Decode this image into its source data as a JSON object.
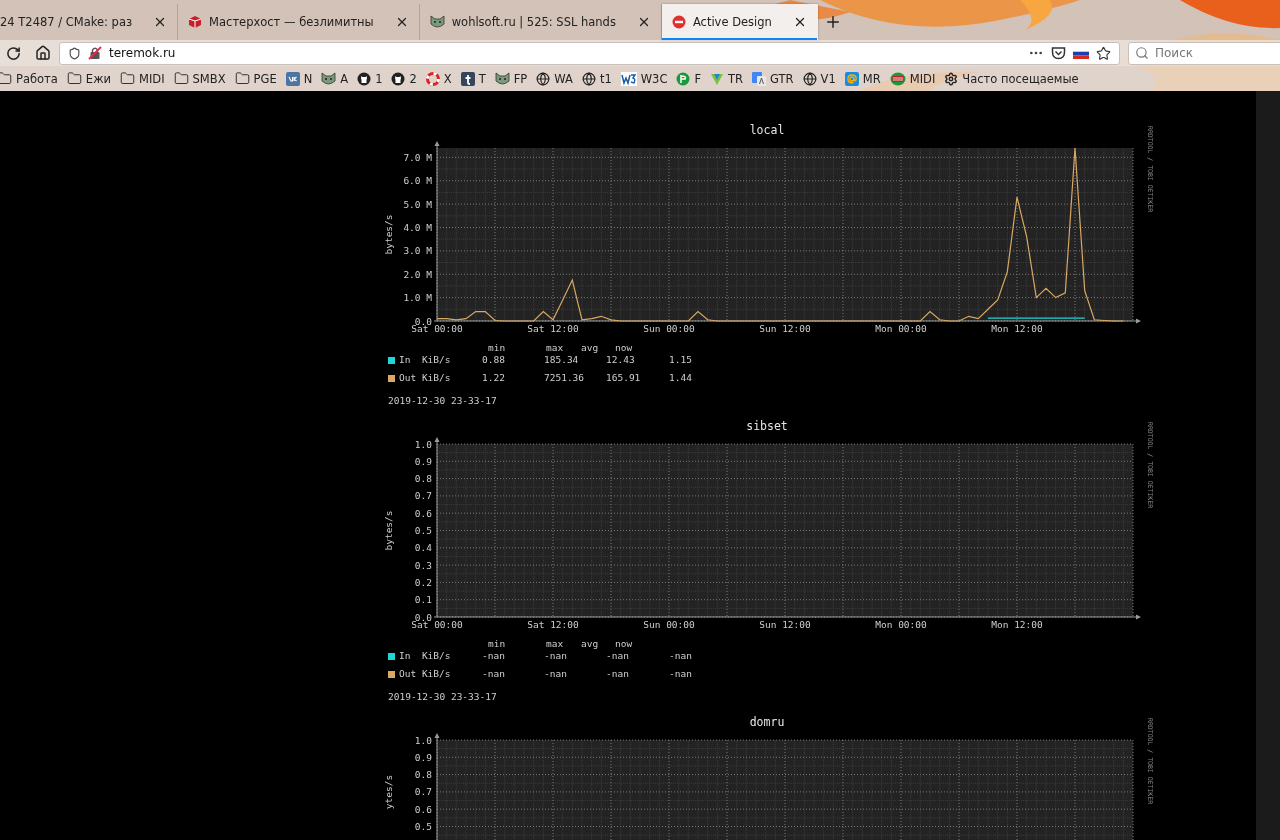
{
  "browser": {
    "tabs": [
      {
        "title": "24 T2487 / CMake: раз",
        "kind": "plain",
        "selected": false
      },
      {
        "title": "Мастерхост — безлимитны",
        "kind": "cube",
        "selected": false
      },
      {
        "title": "wohlsoft.ru | 525: SSL hands",
        "kind": "cat",
        "selected": false
      },
      {
        "title": "Active Design",
        "kind": "stop",
        "selected": true
      }
    ],
    "address_bar": {
      "url": "teremok.ru"
    },
    "search": {
      "placeholder": "Поиск"
    },
    "bookmarks": [
      {
        "label": "Работа",
        "kind": "folder"
      },
      {
        "label": "Ежи",
        "kind": "folder"
      },
      {
        "label": "MIDI",
        "kind": "folder"
      },
      {
        "label": "SMBX",
        "kind": "folder"
      },
      {
        "label": "PGE",
        "kind": "folder"
      },
      {
        "label": "N",
        "kind": "vk"
      },
      {
        "label": "A",
        "kind": "cat"
      },
      {
        "label": "1",
        "kind": "github"
      },
      {
        "label": "2",
        "kind": "github"
      },
      {
        "label": "X",
        "kind": "ring"
      },
      {
        "label": "T",
        "kind": "tsquare"
      },
      {
        "label": "FP",
        "kind": "cat"
      },
      {
        "label": "WA",
        "kind": "globe"
      },
      {
        "label": "t1",
        "kind": "globe"
      },
      {
        "label": "W3C",
        "kind": "w3c"
      },
      {
        "label": "F",
        "kind": "green"
      },
      {
        "label": "TR",
        "kind": "triangle"
      },
      {
        "label": "GTR",
        "kind": "translate"
      },
      {
        "label": "V1",
        "kind": "globe"
      },
      {
        "label": "MR",
        "kind": "at"
      },
      {
        "label": "MIDI",
        "kind": "midi"
      },
      {
        "label": "Часто посещаемые",
        "kind": "gear"
      }
    ]
  },
  "graphs": [
    {
      "title": "local",
      "credit": "RRDTOOL / TOBI OETIKER",
      "chart_data": {
        "type": "line",
        "grid": true,
        "ylabel": "bytes/s",
        "ylim": [
          0,
          7.4
        ],
        "categories": [
          "Sat 00:00",
          null,
          null,
          null,
          null,
          null,
          null,
          null,
          null,
          null,
          null,
          null,
          "Sat 12:00",
          null,
          null,
          null,
          null,
          null,
          null,
          null,
          null,
          null,
          null,
          null,
          "Sun 00:00",
          null,
          null,
          null,
          null,
          null,
          null,
          null,
          null,
          null,
          null,
          null,
          "Sun 12:00",
          null,
          null,
          null,
          null,
          null,
          null,
          null,
          null,
          null,
          null,
          null,
          "Mon 00:00",
          null,
          null,
          null,
          null,
          null,
          null,
          null,
          null,
          null,
          null,
          null,
          "Mon 12:00",
          null,
          null,
          null,
          null,
          null,
          null,
          null,
          null,
          null,
          null,
          null
        ],
        "yticks": [
          {
            "value": 0,
            "label": "0.0"
          },
          {
            "value": 1,
            "label": "1.0 M"
          },
          {
            "value": 2,
            "label": "2.0 M"
          },
          {
            "value": 3,
            "label": "3.0 M"
          },
          {
            "value": 4,
            "label": "4.0 M"
          },
          {
            "value": 5,
            "label": "5.0 M"
          },
          {
            "value": 6,
            "label": "6.0 M"
          },
          {
            "value": 7,
            "label": "7.0 M"
          }
        ],
        "series": [
          {
            "color": "#1ed6d6",
            "values": [
              null,
              null,
              null,
              null,
              null,
              null,
              null,
              null,
              null,
              null,
              null,
              null,
              null,
              null,
              null,
              null,
              null,
              null,
              null,
              null,
              null,
              null,
              null,
              null,
              null,
              null,
              null,
              null,
              null,
              null,
              null,
              null,
              null,
              null,
              null,
              null,
              null,
              null,
              null,
              null,
              null,
              null,
              null,
              null,
              null,
              null,
              null,
              null,
              null,
              null,
              null,
              null,
              null,
              null,
              null,
              null,
              null,
              0.12,
              0.12,
              0.12,
              0.12,
              0.12,
              0.12,
              0.12,
              0.12,
              0.12,
              0.12,
              0.12,
              null,
              null,
              null,
              null
            ]
          },
          {
            "color": "#d9a862",
            "values": [
              0.1,
              0.1,
              0.05,
              0.1,
              0.4,
              0.4,
              0.02,
              0,
              0,
              0,
              0,
              0.4,
              0.05,
              0.9,
              1.75,
              0.05,
              0.1,
              0.2,
              0.05,
              0,
              0,
              0,
              0,
              0,
              0,
              0,
              0,
              0.4,
              0.05,
              0,
              0,
              0,
              0,
              0,
              0,
              0,
              0,
              0,
              0,
              0,
              0,
              0,
              0,
              0,
              0,
              0,
              0,
              0,
              0,
              0,
              0,
              0.4,
              0.05,
              0,
              0,
              0.2,
              0.1,
              0.5,
              0.9,
              2.1,
              5.3,
              3.6,
              1.0,
              1.4,
              1.0,
              1.2,
              7.4,
              1.3,
              0.05,
              0.02,
              0,
              0
            ]
          }
        ]
      },
      "legend": {
        "columns": [
          "min",
          "max",
          "avg",
          "now"
        ],
        "rows": [
          {
            "label": "In  KiB/s",
            "color": "#1ed6d6",
            "values": [
              "0.88",
              "185.34",
              "12.43",
              "1.15"
            ]
          },
          {
            "label": "Out KiB/s",
            "color": "#d9a862",
            "values": [
              "1.22",
              "7251.36",
              "165.91",
              "1.44"
            ]
          }
        ]
      },
      "timestamp": "2019-12-30 23-33-17"
    },
    {
      "title": "sibset",
      "credit": "RRDTOOL / TOBI OETIKER",
      "chart_data": {
        "type": "line",
        "grid": true,
        "ylabel": "bytes/s",
        "ylim": [
          0,
          1
        ],
        "categories": [
          "Sat 00:00",
          null,
          null,
          null,
          null,
          null,
          null,
          null,
          null,
          null,
          null,
          null,
          "Sat 12:00",
          null,
          null,
          null,
          null,
          null,
          null,
          null,
          null,
          null,
          null,
          null,
          "Sun 00:00",
          null,
          null,
          null,
          null,
          null,
          null,
          null,
          null,
          null,
          null,
          null,
          "Sun 12:00",
          null,
          null,
          null,
          null,
          null,
          null,
          null,
          null,
          null,
          null,
          null,
          "Mon 00:00",
          null,
          null,
          null,
          null,
          null,
          null,
          null,
          null,
          null,
          null,
          null,
          "Mon 12:00",
          null,
          null,
          null,
          null,
          null,
          null,
          null,
          null,
          null,
          null,
          null
        ],
        "yticks": [
          {
            "value": 0,
            "label": "0.0"
          },
          {
            "value": 0.1,
            "label": "0.1"
          },
          {
            "value": 0.2,
            "label": "0.2"
          },
          {
            "value": 0.3,
            "label": "0.3"
          },
          {
            "value": 0.4,
            "label": "0.4"
          },
          {
            "value": 0.5,
            "label": "0.5"
          },
          {
            "value": 0.6,
            "label": "0.6"
          },
          {
            "value": 0.7,
            "label": "0.7"
          },
          {
            "value": 0.8,
            "label": "0.8"
          },
          {
            "value": 0.9,
            "label": "0.9"
          },
          {
            "value": 1,
            "label": "1.0"
          }
        ]
      },
      "legend": {
        "columns": [
          "min",
          "max",
          "avg",
          "now"
        ],
        "rows": [
          {
            "label": "In  KiB/s",
            "color": "#1ed6d6",
            "values": [
              "-nan",
              "-nan",
              "-nan",
              "-nan"
            ]
          },
          {
            "label": "Out KiB/s",
            "color": "#d9a862",
            "values": [
              "-nan",
              "-nan",
              "-nan",
              "-nan"
            ]
          }
        ]
      },
      "timestamp": "2019-12-30 23-33-17"
    },
    {
      "title": "domru",
      "credit": "RRDTOOL / TOBI OETIKER",
      "chart_data": {
        "type": "line",
        "grid": true,
        "ylabel": "ytes/s",
        "ylim": [
          0,
          1
        ],
        "categories": [
          null,
          null,
          null,
          null,
          null,
          null,
          null,
          null,
          null,
          null,
          null,
          null,
          null,
          null,
          null,
          null,
          null,
          null,
          null,
          null,
          null,
          null,
          null,
          null,
          null,
          null,
          null,
          null,
          null,
          null,
          null,
          null,
          null,
          null,
          null,
          null,
          null,
          null,
          null,
          null,
          null,
          null,
          null,
          null,
          null,
          null,
          null,
          null,
          null,
          null,
          null,
          null,
          null,
          null,
          null,
          null,
          null,
          null,
          null,
          null,
          null,
          null,
          null,
          null,
          null,
          null,
          null,
          null,
          null,
          null,
          null,
          null
        ],
        "yticks": [
          {
            "value": 0.5,
            "label": "0.5"
          },
          {
            "value": 0.6,
            "label": "0.6"
          },
          {
            "value": 0.7,
            "label": "0.7"
          },
          {
            "value": 0.8,
            "label": "0.8"
          },
          {
            "value": 0.9,
            "label": "0.9"
          },
          {
            "value": 1,
            "label": "1.0"
          }
        ]
      }
    }
  ]
}
